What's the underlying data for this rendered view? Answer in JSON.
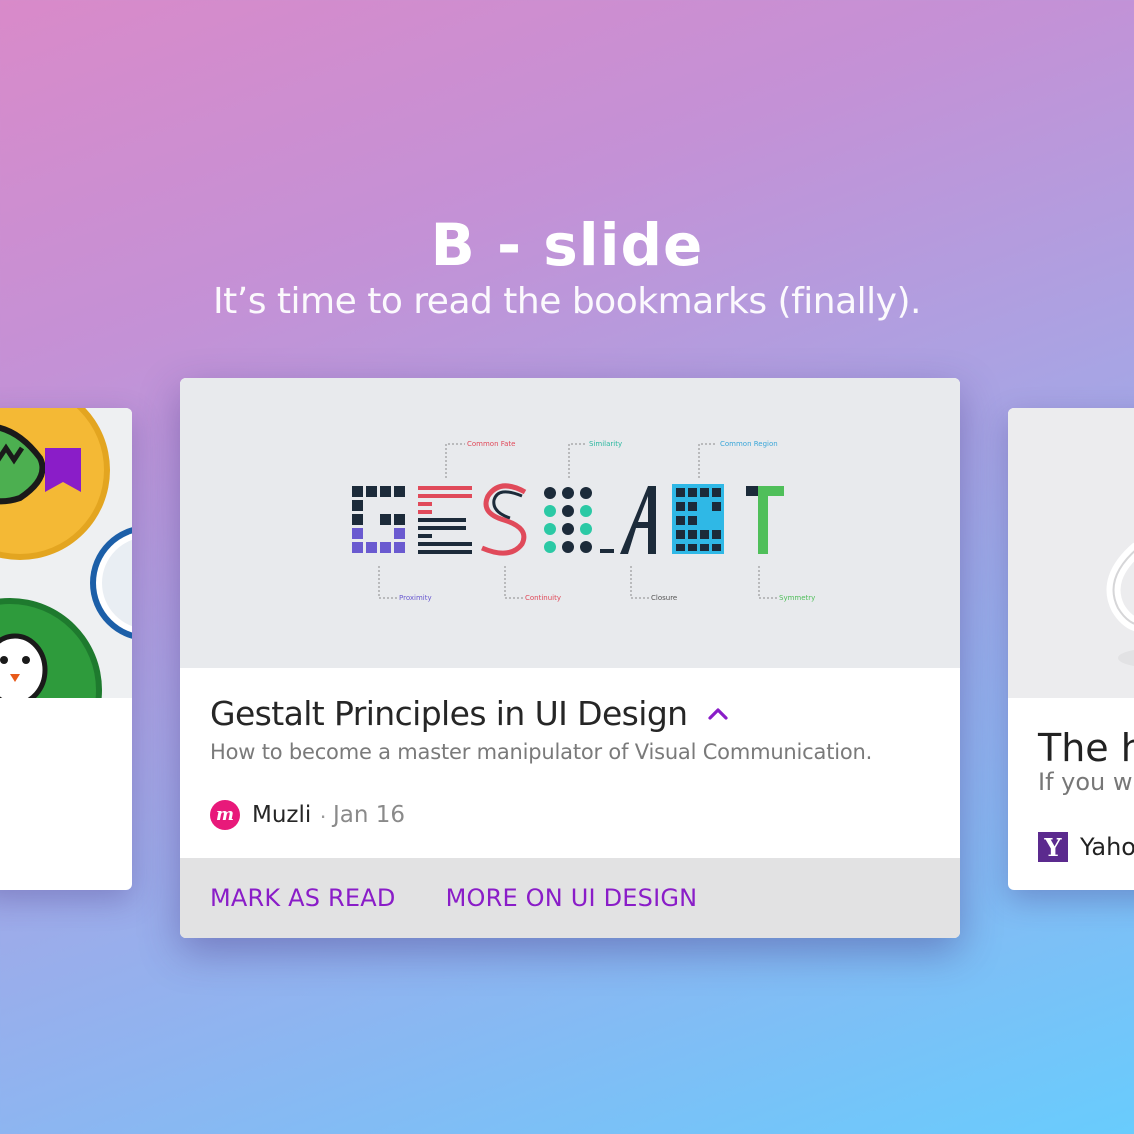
{
  "heading": {
    "title": "B - slide",
    "subtitle": "It’s time to read the bookmarks (finally)."
  },
  "main_card": {
    "image": {
      "word": "GESTALT",
      "labels": {
        "common_fate": "Common Fate",
        "similarity": "Similarity",
        "common_region": "Common Region",
        "proximity": "Proximity",
        "continuity": "Continuity",
        "closure": "Closure",
        "symmetry": "Symmetry"
      }
    },
    "title": "Gestalt Principles in UI Design",
    "subtitle": "How to become a master manipulator of Visual Communication.",
    "source": {
      "name": "Muzli",
      "separator": "·",
      "date": "Jan 16",
      "logo_letter": "m"
    },
    "actions": {
      "mark_read": "Mark as read",
      "more": "More on UI design"
    }
  },
  "right_card": {
    "title": "The he",
    "subtitle": "If you wa",
    "source": {
      "name": "Yaho",
      "logo_letter": "Y"
    }
  },
  "colors": {
    "accent": "#8a1dc8",
    "bookmark": "#8a1dc8",
    "muzli": "#e8197a",
    "yahoo": "#5b2a8e"
  },
  "icons": {
    "bookmark": "bookmark-icon",
    "chevron": "chevron-up-icon"
  }
}
